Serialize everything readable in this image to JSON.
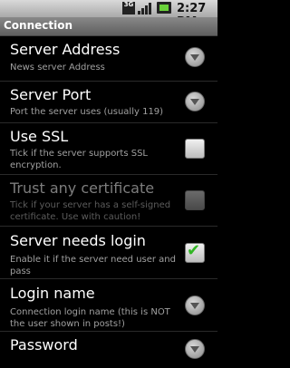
{
  "status_bar": {
    "network": "3G",
    "time": "2:27 PM"
  },
  "title_bar": {
    "title": "Connection"
  },
  "settings": [
    {
      "label": "Server Address",
      "summary": "News server Address",
      "control": "dropdown"
    },
    {
      "label": "Server Port",
      "summary": "Port the server uses (usually 119)",
      "control": "dropdown"
    },
    {
      "label": "Use SSL",
      "summary": "Tick if the server supports SSL encryption.",
      "control": "checkbox",
      "checked": false
    },
    {
      "label": "Trust any certificate",
      "summary": "Tick if your server has a self-signed certificate. Use with caution!",
      "control": "checkbox",
      "checked": false,
      "enabled": false
    },
    {
      "label": "Server needs login",
      "summary": "Enable it if the server need user and pass",
      "control": "checkbox",
      "checked": true
    },
    {
      "label": "Login name",
      "summary": "Connection login name (this is NOT the user shown in posts!)",
      "control": "dropdown"
    },
    {
      "label": "Password",
      "summary": "",
      "control": "dropdown"
    }
  ],
  "colors": {
    "background": "#000000",
    "title_bar": "#6e6e6e",
    "check": "#32b624"
  }
}
